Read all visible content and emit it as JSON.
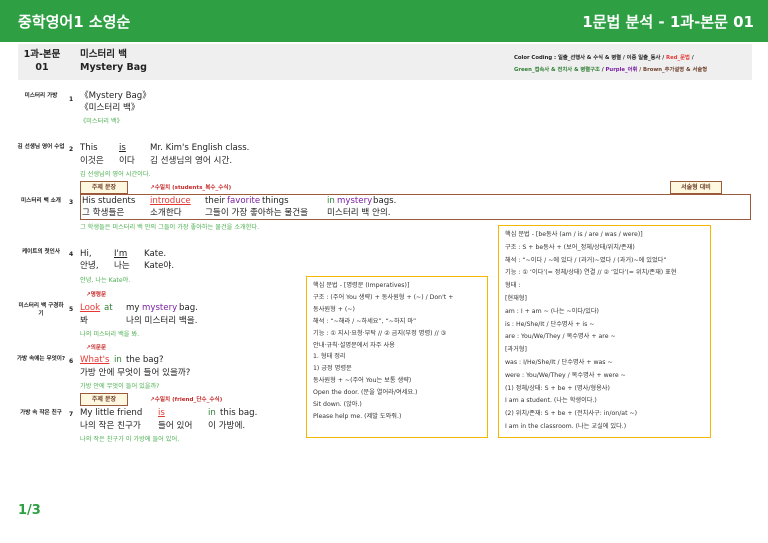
{
  "header": {
    "title": "중학영어1 소영순",
    "right": "1문법 분석 - 1과-본문 01"
  },
  "lesson": {
    "chapter_line1": "1과-본문",
    "chapter_line2": "01",
    "title_ko": "미스터리 백",
    "title_en": "Mystery Bag"
  },
  "color_coding": {
    "line1_a": "Color Coding : 일출_선행사 & 수식 & 병렬 / 이중 일출_동사 / ",
    "line1_b": "Red_문법",
    "line1_c": " /",
    "line2_a": "Green_접속사 & 전치사 & 병렬구조",
    "line2_b": " / ",
    "line2_c": "Purple_어휘",
    "line2_d": " / Brown_추가설명 & 서술형",
    "colors": {
      "red": "#e53935",
      "green": "#2e7d32",
      "purple": "#7b1fa2",
      "brown": "#6d3f2a"
    }
  },
  "rows": [
    {
      "label": "미스터리 가방",
      "num": "1",
      "en": "《Mystery Bag》",
      "ko": "《미스터리 백》",
      "gloss": "《미스터리 백》"
    },
    {
      "label": "김 선생님 영어 수업",
      "num": "2",
      "en_a": "This",
      "en_b": "is",
      "en_c": "Mr. Kim's English class.",
      "ko_a": "이것은",
      "ko_b": "이다",
      "ko_c": "김 선생님의 영어 시간.",
      "gloss": "김 선생님의 영어 시간이다."
    },
    {
      "label": "미스터리 백 소개",
      "num": "3",
      "tag": "주제 문장",
      "note": "수일치 (students_복수_수식)",
      "side_tag": "서술형 대비",
      "en_a": "His students",
      "en_b": "introduce",
      "en_c": "their",
      "en_d": "favorite",
      "en_e": "things",
      "en_f": "in",
      "en_g": "mystery",
      "en_h": "bags.",
      "ko_a": "그 학생들은",
      "ko_b": "소개한다",
      "ko_c": "그들이 가장 좋아하는 물건을",
      "ko_d": "미스터리 백 안의.",
      "gloss": "그 학생들은 미스터리 백 안의 그들이 가장 좋아하는 물건을 소개한다."
    },
    {
      "label": "케이트의 첫인사",
      "num": "4",
      "en_a": "Hi,",
      "en_b": "I'm",
      "en_c": "Kate.",
      "ko_a": "안녕,",
      "ko_b": "나는",
      "ko_c": "Kate야.",
      "gloss": "안녕, 나는 Kate야."
    },
    {
      "label": "미스터리 백 구경하기",
      "num": "5",
      "note": "명령문",
      "en_a": "Look",
      "en_b": "at",
      "en_c": "my",
      "en_d": "mystery",
      "en_e": "bag.",
      "ko_a": "봐",
      "ko_b": "나의 미스터리 백을.",
      "gloss": "나의 미스터리 백을 봐."
    },
    {
      "label": "가방 속에는 무엇이?",
      "num": "6",
      "note": "의문문",
      "en_a": "What's",
      "en_b": "in",
      "en_c": "the bag?",
      "ko": "가방 안에 무엇이 들어 있을까?",
      "gloss": "가방 안에 무엇이 들어 있을까?"
    },
    {
      "label": "가방 속 작은 친구",
      "num": "7",
      "tag": "주제 문장",
      "note": "수일치 (friend_단수_수식)",
      "en_a": "My little friend",
      "en_b": "is",
      "en_c": "in",
      "en_d": "this bag.",
      "ko_a": "나의 작은 친구가",
      "ko_b": "들어 있어",
      "ko_c": "이 가방에.",
      "gloss": "나의 작은 친구가 이 가방에 들어 있어."
    }
  ],
  "imperative_box": [
    "핵심 문법 - [명령문 (Imperatives)]",
    "구조 : (주어 You 생략) + 동사원형 + (~) / Don't +",
    "동사원형 + (~)",
    "해석 : “~해라 / ~하세요”, “~하지 마”",
    "기능 : ① 지시·요청·부탁 // ② 금지(부정 명령) // ③",
    "안내·규칙·설명문에서 자주 사용",
    "1. 형태 정리",
    "1) 긍정 명령문",
    "동사원형 + ~(주어 You는 보통 생략)",
    "Open the door. (문을 열어라/여세요.)",
    "Sit down. (앉아.)",
    "Please help me. (제발 도와줘.)"
  ],
  "be_box": [
    "핵심 문법 - [be동사 (am / is / are / was / were)]",
    "구조 : S + be동사 + (보어_정체/상태/위치/존재)",
    "해석 : “~이다 / ~에 있다 / (과거)~였다 / (과거)~에 있었다”",
    "기능 : ① ‘이다’(= 정체/상태) 연결 // ② ‘있다’(= 위치/존재) 표현",
    "형태 :",
    "[현재형]",
    "am : I + am ~ (나는 ~이다/있다)",
    "is : He/She/It / 단수명사 + is ~",
    "are : You/We/They / 복수명사 + are ~",
    "[과거형]",
    "was : I/He/She/It / 단수명사 + was ~",
    "were : You/We/They / 복수명사 + were ~",
    "(1) 정체/상태: S + be + (명사/형용사)",
    "I am a student. (나는 학생이다.)",
    "(2) 위치/존재: S + be + (전치사구: in/on/at ~)",
    "I am in the classroom. (나는 교실에 있다.)"
  ],
  "page": "1/3"
}
